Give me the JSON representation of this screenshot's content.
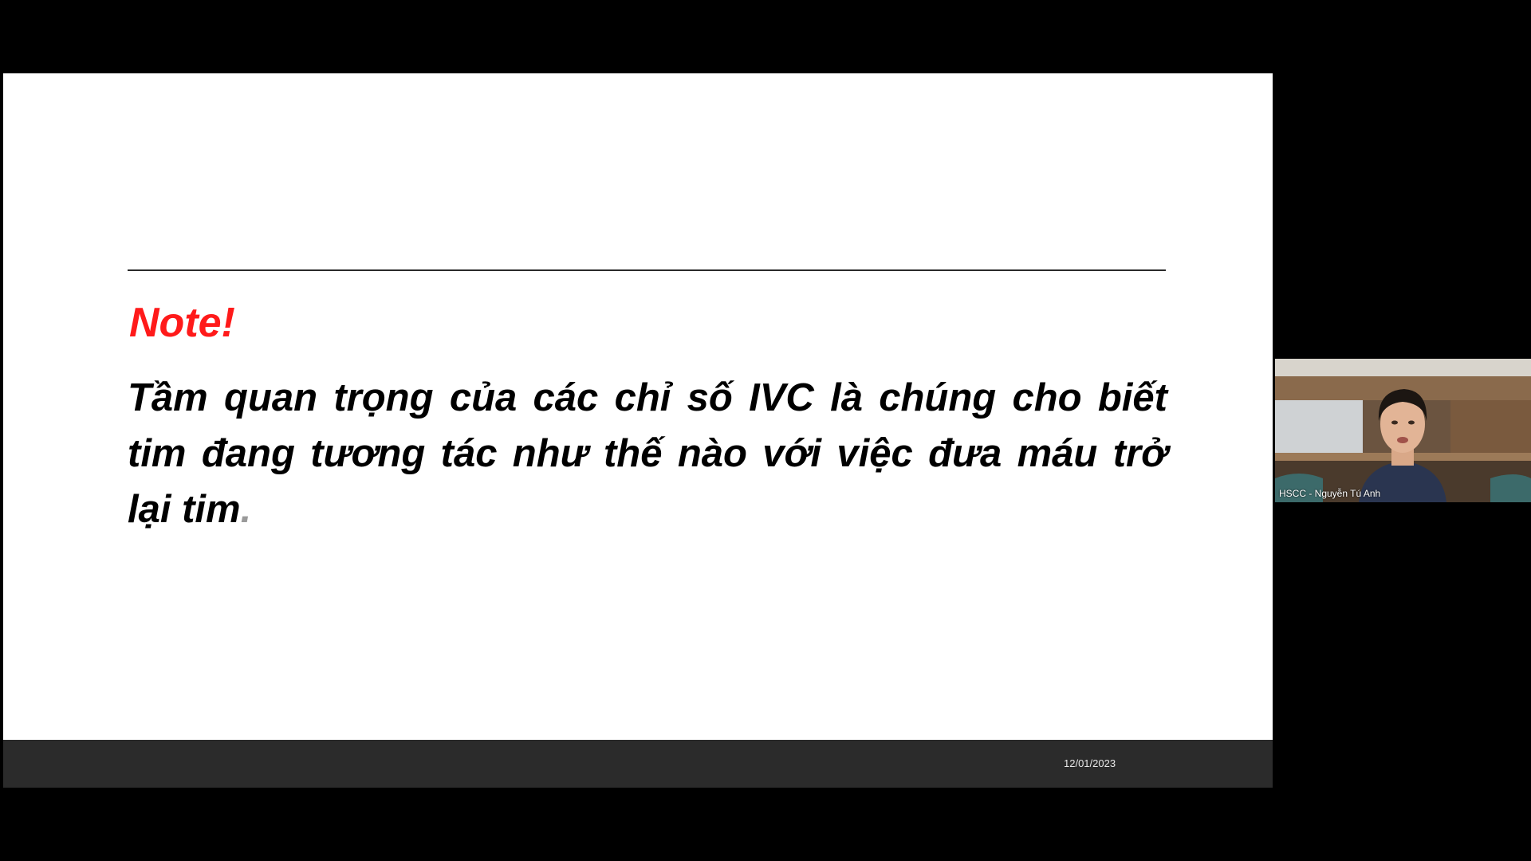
{
  "slide": {
    "heading": "Note!",
    "body": "Tầm quan trọng của các chỉ số IVC là chúng cho biết tim đang tương tác như thế nào với việc đưa máu trở lại tim",
    "body_end": ".",
    "footer_date": "12/01/2023"
  },
  "participant": {
    "name": "HSCC - Nguyễn Tú Anh"
  },
  "colors": {
    "heading": "#ff1a1a",
    "body": "#000000",
    "footer": "#2b2b2b",
    "background": "#000000"
  }
}
